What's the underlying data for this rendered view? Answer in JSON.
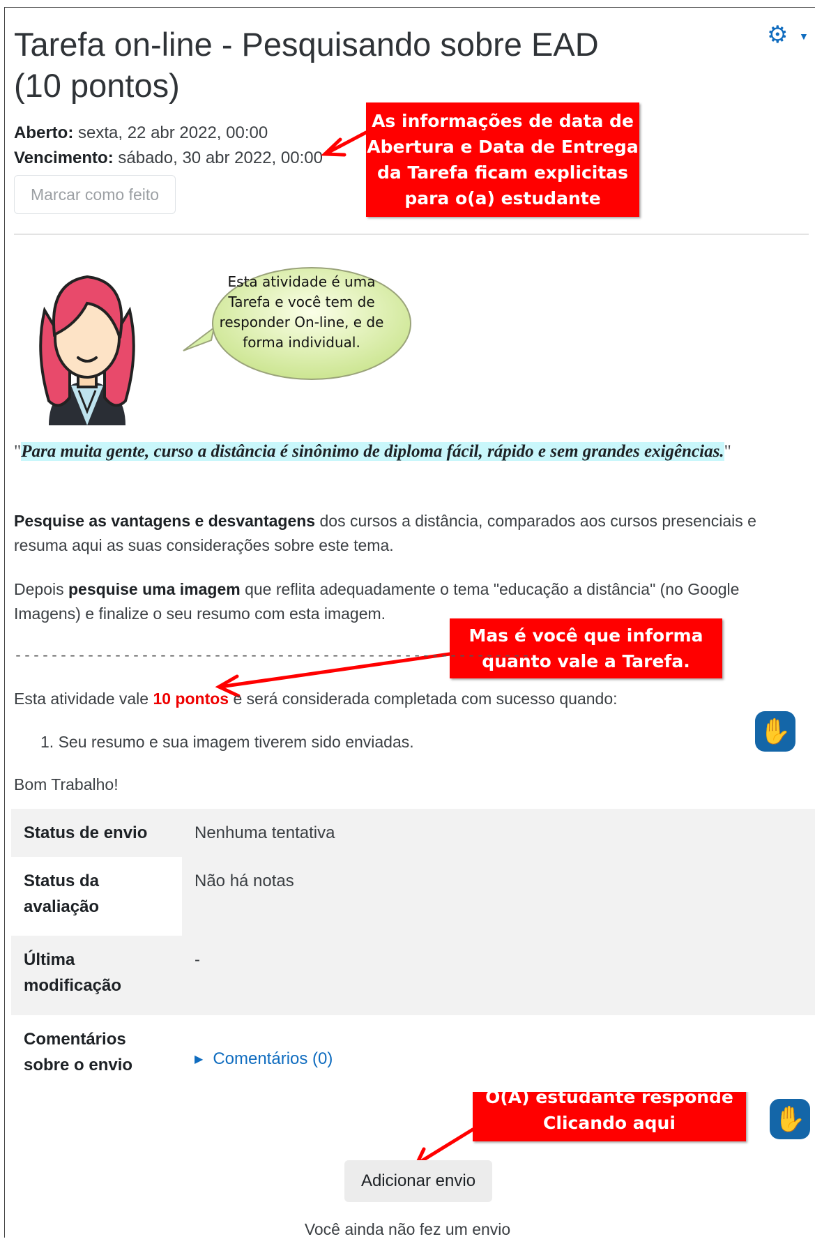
{
  "page": {
    "title": "Tarefa on-line - Pesquisando sobre EAD (10 pontos)",
    "dates": {
      "open_label": "Aberto:",
      "open_value": "sexta, 22 abr 2022, 00:00",
      "due_label": "Vencimento:",
      "due_value": "sábado, 30 abr 2022, 00:00"
    },
    "mark_done_label": "Marcar como feito",
    "settings_icon": "gear-icon"
  },
  "callouts": {
    "dates_note": "As informações de data de Abertura e Data de Entrega da Tarefa ficam explicitas para o(a) estudante",
    "points_note": "Mas é você que informa quanto vale a Tarefa.",
    "submit_note": "O(A) estudante responde Clicando aqui"
  },
  "intro": {
    "bubble_text": "Esta atividade é uma Tarefa e você tem de responder On-line, e de forma individual.",
    "quote_open": "\"",
    "quote": "Para muita gente, curso a distância é sinônimo de diploma fácil, rápido e sem grandes exigências.",
    "quote_close": "\"",
    "p1_bold": "Pesquise as vantagens e desvantagens",
    "p1_rest": " dos cursos a distância, comparados aos cursos presenciais e resuma aqui as suas considerações sobre este tema.",
    "p2_start": "Depois ",
    "p2_bold": "pesquise uma imagem",
    "p2_rest": " que reflita adequadamente o tema \"educação a distância\" (no Google Imagens) e finalize o seu resumo com esta imagem.",
    "dashes": "---------------------------------------------------------",
    "p3_start": "Esta atividade vale ",
    "p3_points": "10 pontos",
    "p3_rest": " e será considerada completada com sucesso quando:",
    "list_item": "1. Seu resumo e sua imagem tiverem sido enviadas.",
    "closing": "Bom Trabalho!"
  },
  "status_table": {
    "rows": [
      {
        "label": "Status de envio",
        "value": "Nenhuma tentativa"
      },
      {
        "label": "Status da avaliação",
        "value": "Não há notas"
      },
      {
        "label": "Última modificação",
        "value": "-"
      },
      {
        "label": "Comentários sobre o envio",
        "value": "Comentários (0)"
      }
    ]
  },
  "actions": {
    "add_submission": "Adicionar envio",
    "no_submission_note": "Você ainda não fez um envio"
  },
  "colors": {
    "callout_red": "#ff0000",
    "link_blue": "#0f6cbf",
    "highlight": "#c9f7fb",
    "bubble_green": "#d8f0a8"
  }
}
